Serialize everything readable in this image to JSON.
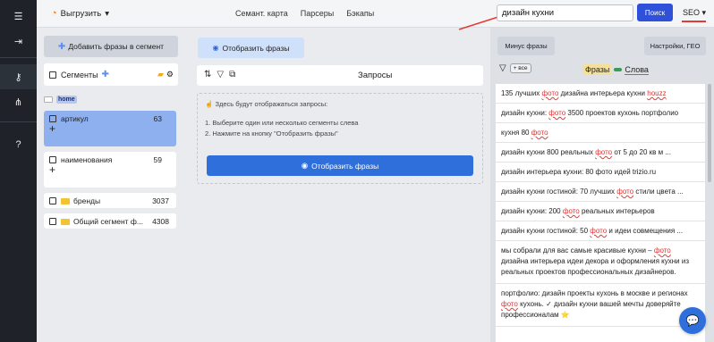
{
  "rail": {
    "icons": [
      "menu-icon",
      "login-icon",
      "key-icon",
      "hierarchy-icon",
      "help-icon"
    ]
  },
  "topbar": {
    "export_label": "Выгрузить",
    "nav": [
      "Семант. карта",
      "Парсеры",
      "Бэкапы"
    ],
    "search_value": "дизайн кухни",
    "search_button": "Поиск",
    "seo_label": "SEO"
  },
  "segments": {
    "add_button": "Добавить фразы в сегмент",
    "header_label": "Сегменты",
    "home_tag": "home",
    "items": [
      {
        "label": "артикул",
        "count": "63"
      },
      {
        "label": "наименования",
        "count": "59"
      },
      {
        "label": "бренды",
        "count": "3037"
      },
      {
        "label": "Общий сегмент ф...",
        "count": "4308"
      }
    ]
  },
  "middle": {
    "show_button_top": "Отобразить фразы",
    "header_title": "Запросы",
    "hint": "Здесь будут отображаться запросы:",
    "step1": "1. Выберите один или несколько сегменты слева",
    "step2": "2. Нажмите на кнопку \"Отобразить фразы\"",
    "show_button_main": "Отобразить фразы"
  },
  "right": {
    "minus_button": "Минус фразы",
    "settings_button": "Настройки, ГЕО",
    "all_tag": "+ все",
    "toggle_phrases": "Фразы",
    "toggle_words": "Слова",
    "results": [
      {
        "pre": "135 лучших ",
        "w": "фото",
        "post": " дизайна интерьера кухни ",
        "w2": "houzz"
      },
      {
        "pre": "дизайн кухни: ",
        "w": "фото",
        "post": " 3500 проектов кухонь портфолио"
      },
      {
        "pre": "кухня 80 ",
        "w": "фото",
        "post": ""
      },
      {
        "pre": "дизайн кухни 800 реальных ",
        "w": "фото",
        "post": " от 5 до 20 кв м ..."
      },
      {
        "pre": "дизайн интерьера кухни: 80 фото идей trizio.ru",
        "w": "",
        "post": ""
      },
      {
        "pre": "дизайн кухни гостиной: 70 лучших ",
        "w": "фото",
        "post": " стили цвета ..."
      },
      {
        "pre": "дизайн кухни: 200 ",
        "w": "фото",
        "post": " реальных интерьеров"
      },
      {
        "pre": "дизайн кухни гостиной: 50 ",
        "w": "фото",
        "post": " и идеи совмещения ..."
      }
    ],
    "long1": {
      "a": "мы собрали для вас самые красивые кухни – ",
      "w": "фото",
      "b": " дизайна интерьера идеи декора и оформления кухни из реальных проектов профессиональных дизайнеров."
    },
    "long2": {
      "a": "портфолио: дизайн проекты кухонь в москве и регионах ",
      "w": "фото",
      "b": " кухонь. ✓ дизайн кухни вашей мечты доверяйте профессионалам ⭐"
    }
  },
  "colors": {
    "accent": "#2f6fdc",
    "search_button": "#2f50d8",
    "active_segment": "#8fb0ef",
    "sidebar": "#1f2329"
  }
}
